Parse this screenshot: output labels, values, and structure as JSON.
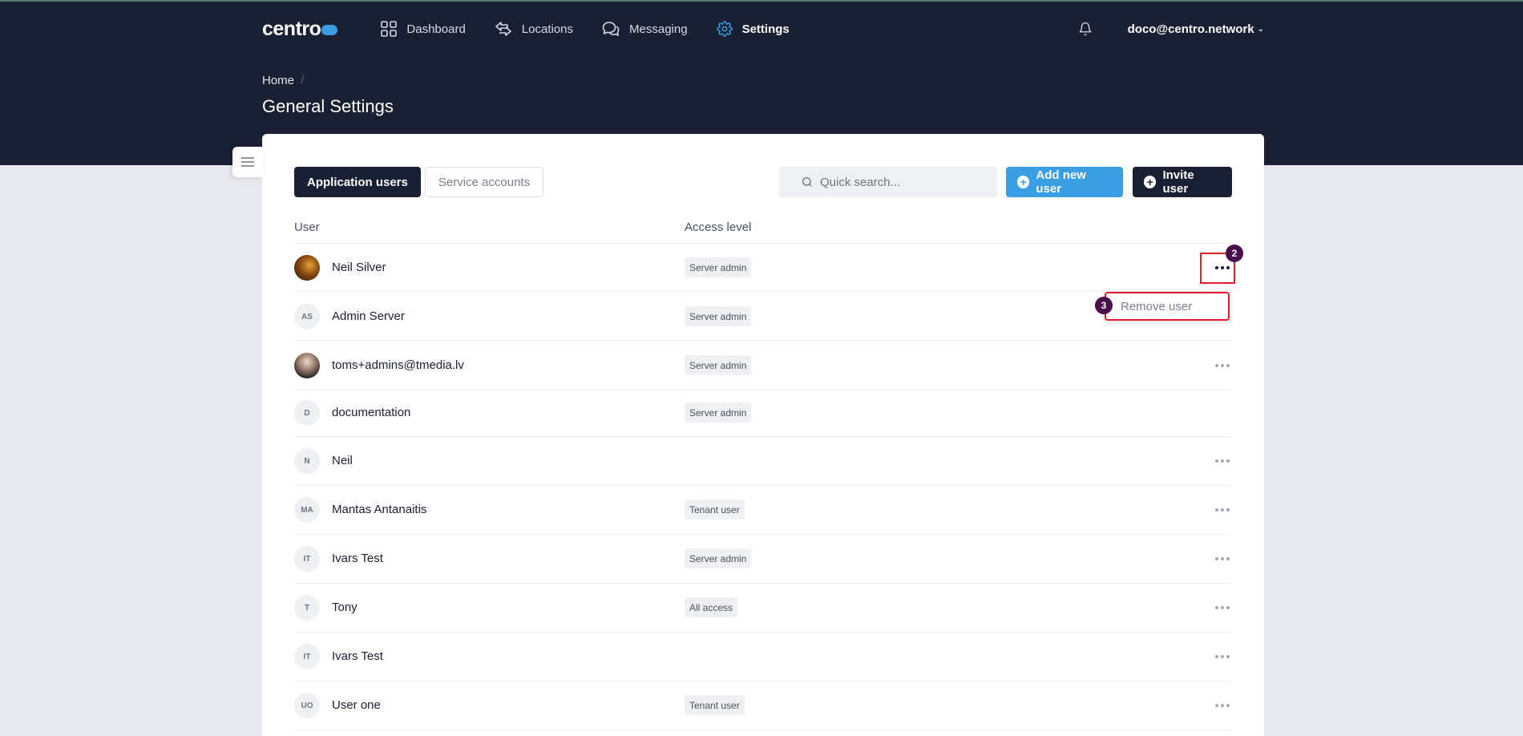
{
  "app": {
    "logo_text": "centro"
  },
  "nav": {
    "items": [
      {
        "label": "Dashboard",
        "icon": "grid-icon"
      },
      {
        "label": "Locations",
        "icon": "arrows-icon"
      },
      {
        "label": "Messaging",
        "icon": "chat-icon"
      },
      {
        "label": "Settings",
        "icon": "gear-icon"
      }
    ],
    "active_index": 3,
    "account": "doco@centro.network"
  },
  "breadcrumb": {
    "home": "Home",
    "separator": "/"
  },
  "page": {
    "title": "General Settings"
  },
  "tabs": {
    "application_users": "Application users",
    "service_accounts": "Service accounts"
  },
  "search": {
    "placeholder": "Quick search..."
  },
  "buttons": {
    "add_new_user": "Add new user",
    "invite_user": "Invite user"
  },
  "table": {
    "headers": {
      "user": "User",
      "access_level": "Access level"
    },
    "rows": [
      {
        "name": "Neil Silver",
        "avatar": "photo",
        "initials": "",
        "access": "Server admin",
        "menu": true
      },
      {
        "name": "Admin Server",
        "avatar": "initials",
        "initials": "AS",
        "access": "Server admin",
        "menu": false
      },
      {
        "name": "toms+admins@tmedia.lv",
        "avatar": "photo",
        "initials": "",
        "access": "Server admin",
        "menu": true
      },
      {
        "name": "documentation",
        "avatar": "initials",
        "initials": "D",
        "access": "Server admin",
        "menu": false
      },
      {
        "name": "Neil",
        "avatar": "initials",
        "initials": "N",
        "access": "",
        "menu": true
      },
      {
        "name": "Mantas Antanaitis",
        "avatar": "initials",
        "initials": "MA",
        "access": "Tenant user",
        "menu": true
      },
      {
        "name": "Ivars Test",
        "avatar": "initials",
        "initials": "IT",
        "access": "Server admin",
        "menu": true
      },
      {
        "name": "Tony",
        "avatar": "initials",
        "initials": "T",
        "access": "All access",
        "menu": true
      },
      {
        "name": "Ivars Test",
        "avatar": "initials",
        "initials": "IT",
        "access": "",
        "menu": true
      },
      {
        "name": "User one",
        "avatar": "initials",
        "initials": "UO",
        "access": "Tenant user",
        "menu": true
      }
    ]
  },
  "context_menu": {
    "remove_user": "Remove user"
  },
  "annotations": {
    "step_two": "2",
    "step_three": "3"
  },
  "colors": {
    "header_bg": "#1a2033",
    "accent": "#3a9ee4",
    "highlight": "#e11d2c",
    "step_badge": "#4a0f4a"
  }
}
